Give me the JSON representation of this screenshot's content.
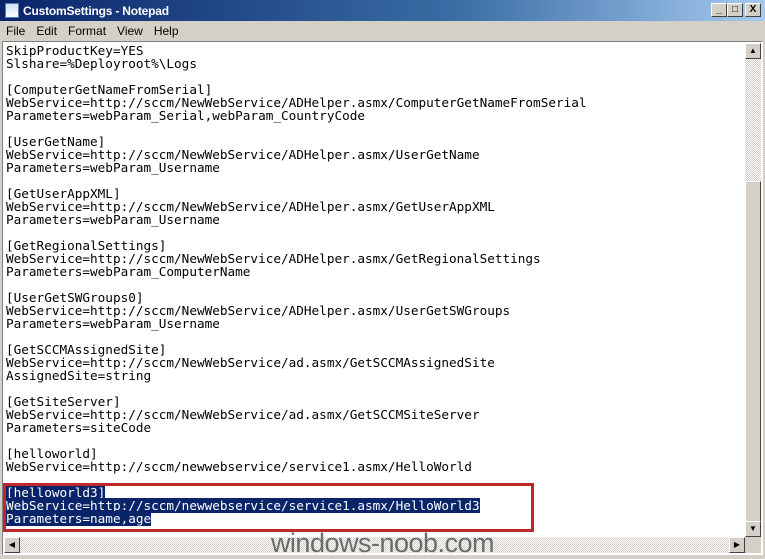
{
  "window": {
    "title": "CustomSettings - Notepad",
    "minimize": "_",
    "maximize": "□",
    "close": "X"
  },
  "menu": [
    {
      "label": "File",
      "key": "F"
    },
    {
      "label": "Edit",
      "key": "E"
    },
    {
      "label": "Format",
      "key": "o"
    },
    {
      "label": "View",
      "key": "V"
    },
    {
      "label": "Help",
      "key": "H"
    }
  ],
  "editor": {
    "lines": [
      "SkipProductKey=YES",
      "Slshare=%Deployroot%\\Logs",
      "",
      "[ComputerGetNameFromSerial]",
      "WebService=http://sccm/NewWebService/ADHelper.asmx/ComputerGetNameFromSerial",
      "Parameters=webParam_Serial,webParam_CountryCode",
      "",
      "[UserGetName]",
      "WebService=http://sccm/NewWebService/ADHelper.asmx/UserGetName",
      "Parameters=webParam_Username",
      "",
      "[GetUserAppXML]",
      "WebService=http://sccm/NewWebService/ADHelper.asmx/GetUserAppXML",
      "Parameters=webParam_Username",
      "",
      "[GetRegionalSettings]",
      "WebService=http://sccm/NewWebService/ADHelper.asmx/GetRegionalSettings",
      "Parameters=webParam_ComputerName",
      "",
      "[UserGetSWGroups0]",
      "WebService=http://sccm/NewWebService/ADHelper.asmx/UserGetSWGroups",
      "Parameters=webParam_Username",
      "",
      "[GetSCCMAssignedSite]",
      "WebService=http://sccm/NewWebService/ad.asmx/GetSCCMAssignedSite",
      "AssignedSite=string",
      "",
      "[GetSiteServer]",
      "WebService=http://sccm/NewWebService/ad.asmx/GetSCCMSiteServer",
      "Parameters=siteCode",
      "",
      "[helloworld]",
      "WebService=http://sccm/newwebservice/service1.asmx/HelloWorld",
      "",
      "[helloworld3]",
      "WebService=http://sccm/newwebservice/service1.asmx/HelloWorld3",
      "Parameters=name,age"
    ],
    "selected_from_line": 34,
    "highlight_color": "#c0282d",
    "selection_color": "#0a246a"
  },
  "scrollbar": {
    "up": "▲",
    "down": "▼",
    "left": "◀",
    "right": "▶"
  },
  "watermark": "windows-noob.com"
}
